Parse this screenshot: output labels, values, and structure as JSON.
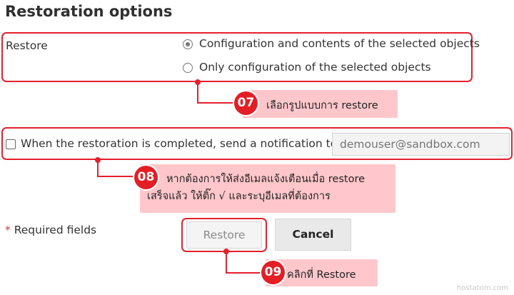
{
  "title": "Restoration options",
  "restore": {
    "label": "Restore",
    "option1": "Configuration and contents of the selected objects",
    "option2": "Only configuration of the selected objects",
    "selected": "option1"
  },
  "notify": {
    "label": "When the restoration is completed, send a notification to",
    "placeholder": "demouser@sandbox.com",
    "checked": false
  },
  "required": {
    "star": "*",
    "text": "Required fields"
  },
  "buttons": {
    "restore": "Restore",
    "cancel": "Cancel"
  },
  "callouts": [
    {
      "num": "07",
      "text": "เลือกรูปแบบการ restore"
    },
    {
      "num": "08",
      "line1": "หากต้องการให้ส่งอีเมลแจ้งเตือนเมื่อ restore",
      "line2": "เสร็จแล้ว ให้ติ๊ก √ และระบุอีเมลที่ต้องการ"
    },
    {
      "num": "09",
      "text": "คลิกที่ Restore"
    }
  ],
  "watermark": "hostatom.com",
  "colors": {
    "accent": "#e3212d",
    "callout_bg": "#ffc7cb"
  }
}
